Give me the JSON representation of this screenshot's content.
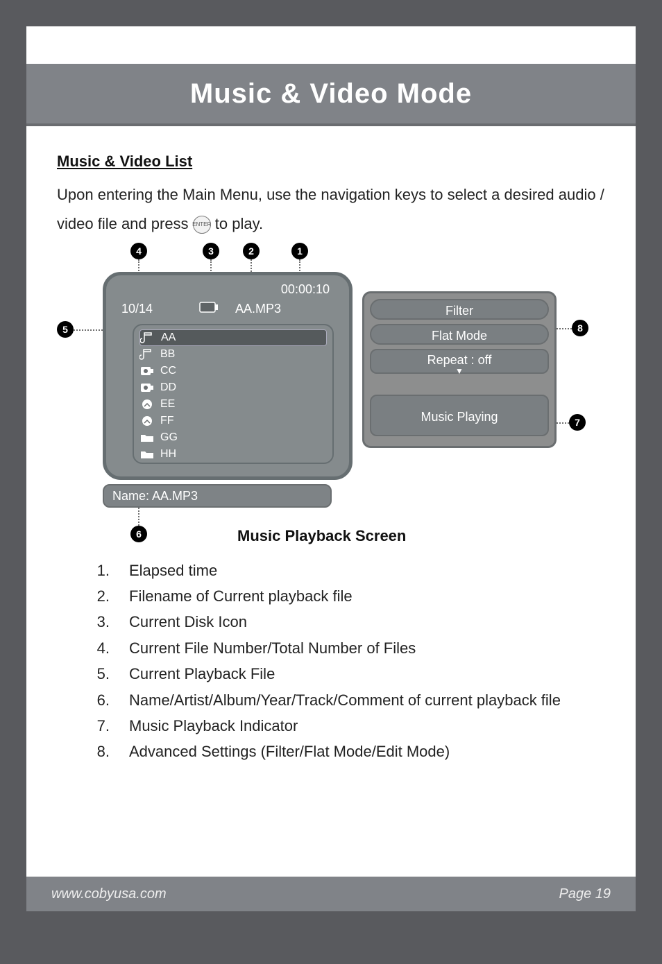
{
  "page_title": "Music & Video Mode",
  "section_heading": "Music & Video List",
  "intro_prefix": "Upon entering the Main Menu, use the navigation keys to select a desired audio / video file and press ",
  "enter_label": "ENTER",
  "intro_suffix": " to play.",
  "device": {
    "elapsed": "00:00:10",
    "counter": "10/14",
    "filename": "AA.MP3",
    "files": [
      {
        "name": "AA",
        "type": "music",
        "selected": true
      },
      {
        "name": "BB",
        "type": "music",
        "selected": false
      },
      {
        "name": "CC",
        "type": "video",
        "selected": false
      },
      {
        "name": "DD",
        "type": "video",
        "selected": false
      },
      {
        "name": "EE",
        "type": "image",
        "selected": false
      },
      {
        "name": "FF",
        "type": "image",
        "selected": false
      },
      {
        "name": "GG",
        "type": "folder",
        "selected": false
      },
      {
        "name": "HH",
        "type": "folder",
        "selected": false
      }
    ],
    "panel": {
      "filter": "Filter",
      "flat": "Flat Mode",
      "repeat_label": "Repeat",
      "repeat_value": ": off",
      "playing": "Music Playing"
    },
    "name_label": "Name:",
    "name_value": "AA.MP3"
  },
  "caption": "Music Playback Screen",
  "callouts": [
    "4",
    "3",
    "2",
    "1",
    "5",
    "6",
    "7",
    "8"
  ],
  "legend": [
    {
      "n": "1.",
      "t": "Elapsed time"
    },
    {
      "n": "2.",
      "t": "Filename of Current playback file"
    },
    {
      "n": "3.",
      "t": "Current Disk Icon"
    },
    {
      "n": "4.",
      "t": "Current File Number/Total Number of Files"
    },
    {
      "n": "5.",
      "t": "Current Playback File"
    },
    {
      "n": "6.",
      "t": "Name/Artist/Album/Year/Track/Comment of current playback file"
    },
    {
      "n": "7.",
      "t": "Music Playback Indicator"
    },
    {
      "n": "8.",
      "t": "Advanced Settings (Filter/Flat Mode/Edit Mode)"
    }
  ],
  "footer": {
    "url": "www.cobyusa.com",
    "page": "Page 19"
  }
}
